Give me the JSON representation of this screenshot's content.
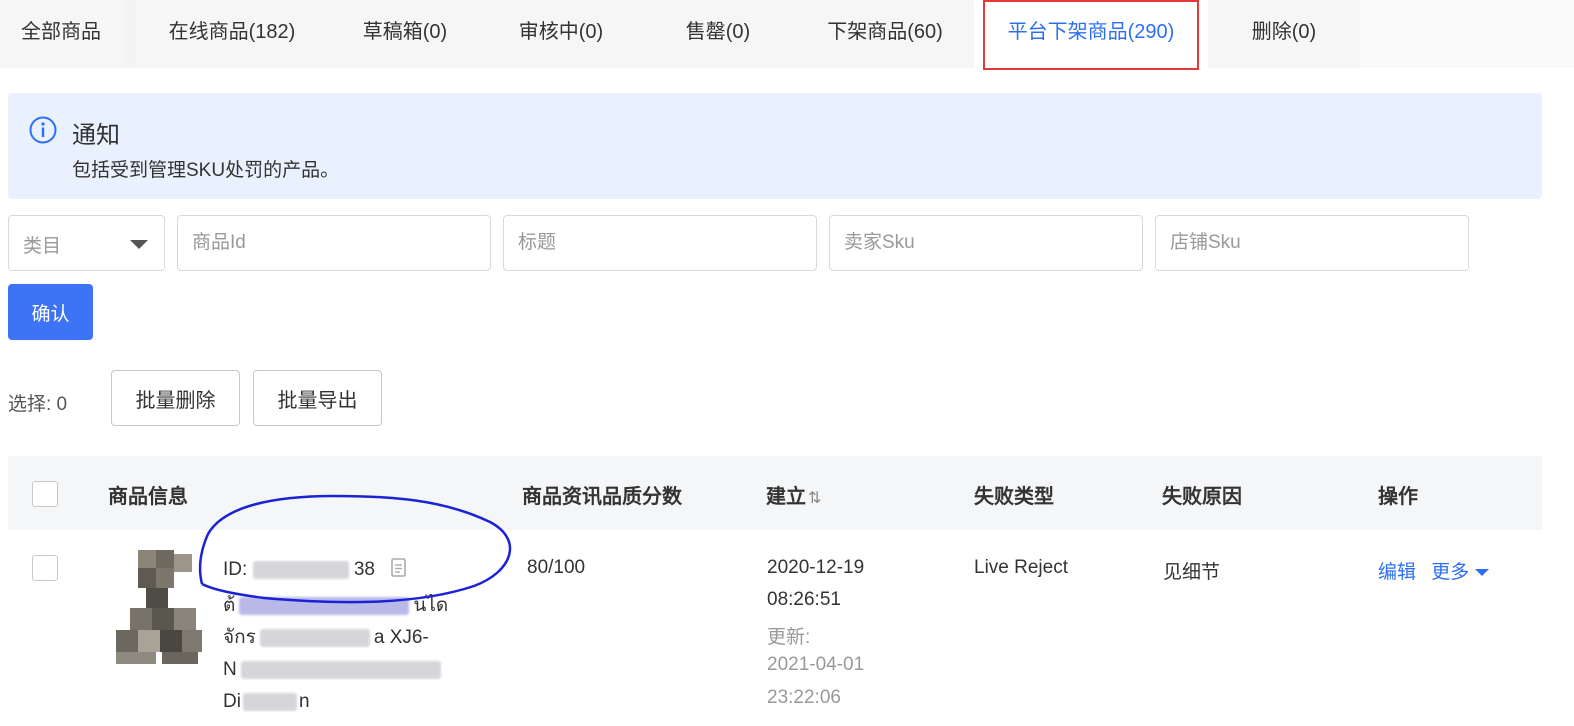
{
  "tabs": [
    {
      "label": "全部商品",
      "active": false
    },
    {
      "label": "在线商品(182)",
      "active": false
    },
    {
      "label": "草稿箱(0)",
      "active": false
    },
    {
      "label": "审核中(0)",
      "active": false
    },
    {
      "label": "售罄(0)",
      "active": false
    },
    {
      "label": "下架商品(60)",
      "active": false
    },
    {
      "label": "平台下架商品(290)",
      "active": true
    },
    {
      "label": "删除(0)",
      "active": false
    }
  ],
  "notice": {
    "title": "通知",
    "text": "包括受到管理SKU处罚的产品。",
    "icon": "info-icon"
  },
  "filters": {
    "category_label": "类目",
    "product_id_placeholder": "商品Id",
    "title_placeholder": "标题",
    "seller_sku_placeholder": "卖家Sku",
    "shop_sku_placeholder": "店铺Sku",
    "confirm_label": "确认"
  },
  "bulk": {
    "selected_label": "选择: 0",
    "delete_label": "批量删除",
    "export_label": "批量导出"
  },
  "table": {
    "headers": {
      "product_info": "商品信息",
      "quality_score": "商品资讯品质分数",
      "created": "建立",
      "failure_type": "失败类型",
      "failure_reason": "失败原因",
      "actions": "操作"
    },
    "rows": [
      {
        "id_prefix": "ID:",
        "id_end": "38",
        "title_line1_start": "ต้",
        "title_line1_end": "นได",
        "title_line2_start": "จักร",
        "title_line2_end": "a XJ6-",
        "title_line3_start": "N",
        "title_line4_start": "Di",
        "title_line4_end": "n",
        "quality_score": "80/100",
        "created_date": "2020-12-19",
        "created_time": "08:26:51",
        "updated_label": "更新:",
        "updated_date": "2021-04-01",
        "updated_time": "23:22:06",
        "failure_type": "Live Reject",
        "failure_reason": "见细节",
        "edit_label": "编辑",
        "more_label": "更多"
      }
    ]
  },
  "colors": {
    "accent": "#2d6ff3",
    "primary_button": "#3d74f6",
    "notice_bg": "#e8f1fd",
    "highlight_box": "#e23a3a",
    "annotation_stroke": "#1a22d6"
  }
}
